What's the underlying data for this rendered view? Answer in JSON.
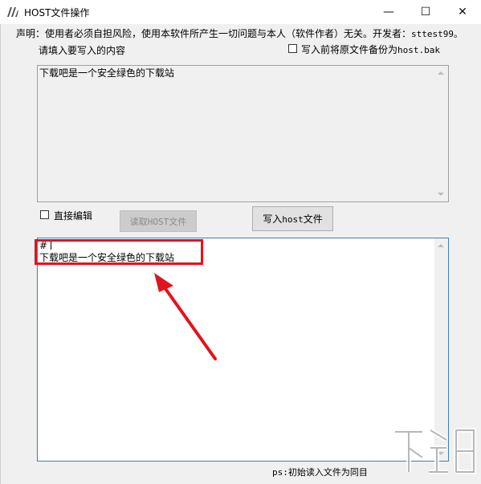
{
  "window": {
    "title": "HOST文件操作",
    "controls": {
      "minimize": "—",
      "maximize": "☐",
      "close": "✕"
    }
  },
  "disclaimer": {
    "text": "声明：使用者必须自担风险，使用本软件所产生一切问题与本人（软件作者）无关。开发者：",
    "developer": "sttest99。"
  },
  "input_section": {
    "label": "请填入要写入的内容",
    "backup_checkbox": {
      "label_prefix": "写入前将原文件备份为",
      "label_file": "host.bak",
      "checked": false
    },
    "content": "下载吧是一个安全绿色的下载站"
  },
  "controls": {
    "direct_edit": {
      "label": "直接编辑",
      "checked": false
    },
    "read_button": {
      "label": "读取HOST文件",
      "enabled": false
    },
    "write_button": {
      "label_prefix": "写入",
      "label_mono": "host",
      "label_suffix": "文件"
    }
  },
  "host_editor": {
    "line1": "#",
    "line2": "下载吧是一个安全绿色的下载站"
  },
  "status": {
    "ps_note": "ps:初始读入文件为同目"
  },
  "annotation": {
    "highlight_color": "#e0141e"
  }
}
